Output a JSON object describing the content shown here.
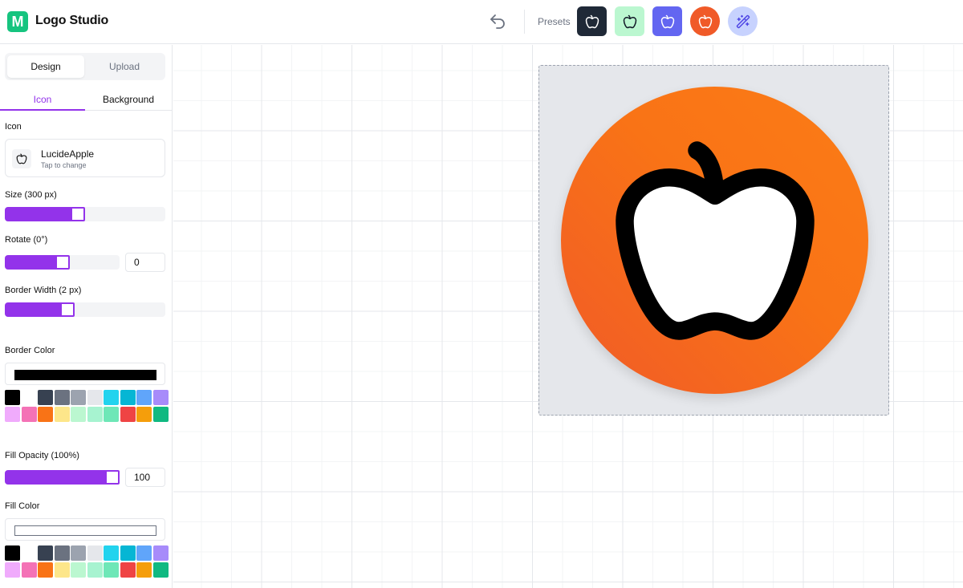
{
  "app": {
    "logo_letter": "M",
    "title": "Logo Studio"
  },
  "header": {
    "presets_label": "Presets",
    "presets": [
      {
        "bg": "#1f2937",
        "fg": "#ffffff",
        "shape": "rounded"
      },
      {
        "bg": "#bbf7d0",
        "fg": "#111827",
        "shape": "rounded"
      },
      {
        "bg": "#6366f1",
        "fg": "#ffffff",
        "shape": "rounded"
      },
      {
        "bg": "#f05a28",
        "fg": "#ffffff",
        "shape": "circle"
      },
      {
        "bg": "#c7d2fe",
        "fg": "#4f46e5",
        "shape": "circle",
        "icon": "magic-wand-icon"
      }
    ]
  },
  "sidebar": {
    "mode_tabs": [
      "Design",
      "Upload"
    ],
    "sub_tabs": [
      "Icon",
      "Background"
    ],
    "icon_section": {
      "label": "Icon",
      "name": "LucideApple",
      "hint": "Tap to change"
    },
    "size": {
      "label": "Size (300 px)",
      "percent": 45
    },
    "rotate": {
      "label": "Rotate (0°)",
      "percent": 50,
      "value": "0"
    },
    "border_width": {
      "label": "Border Width (2 px)",
      "percent": 38
    },
    "border_color": {
      "label": "Border Color",
      "value": "#000000"
    },
    "fill_opacity": {
      "label": "Fill Opacity (100%)",
      "percent": 100,
      "value": "100"
    },
    "fill_color": {
      "label": "Fill Color",
      "value": "#ffffff"
    },
    "swatches": [
      "#000000",
      "#ffffff",
      "#374151",
      "#6b7280",
      "#9ca3af",
      "#e5e7eb",
      "#22d3ee",
      "#06b6d4",
      "#60a5fa",
      "#a78bfa",
      "#f0abfc",
      "#f472b6",
      "#f97316",
      "#fde68a",
      "#bbf7d0",
      "#a7f3d0",
      "#6ee7b7",
      "#ef4444",
      "#f59e0b",
      "#10b981"
    ]
  },
  "colors": {
    "accent": "#9333ea",
    "logo_green": "#16c47f",
    "logo_bg": "#f97316"
  }
}
